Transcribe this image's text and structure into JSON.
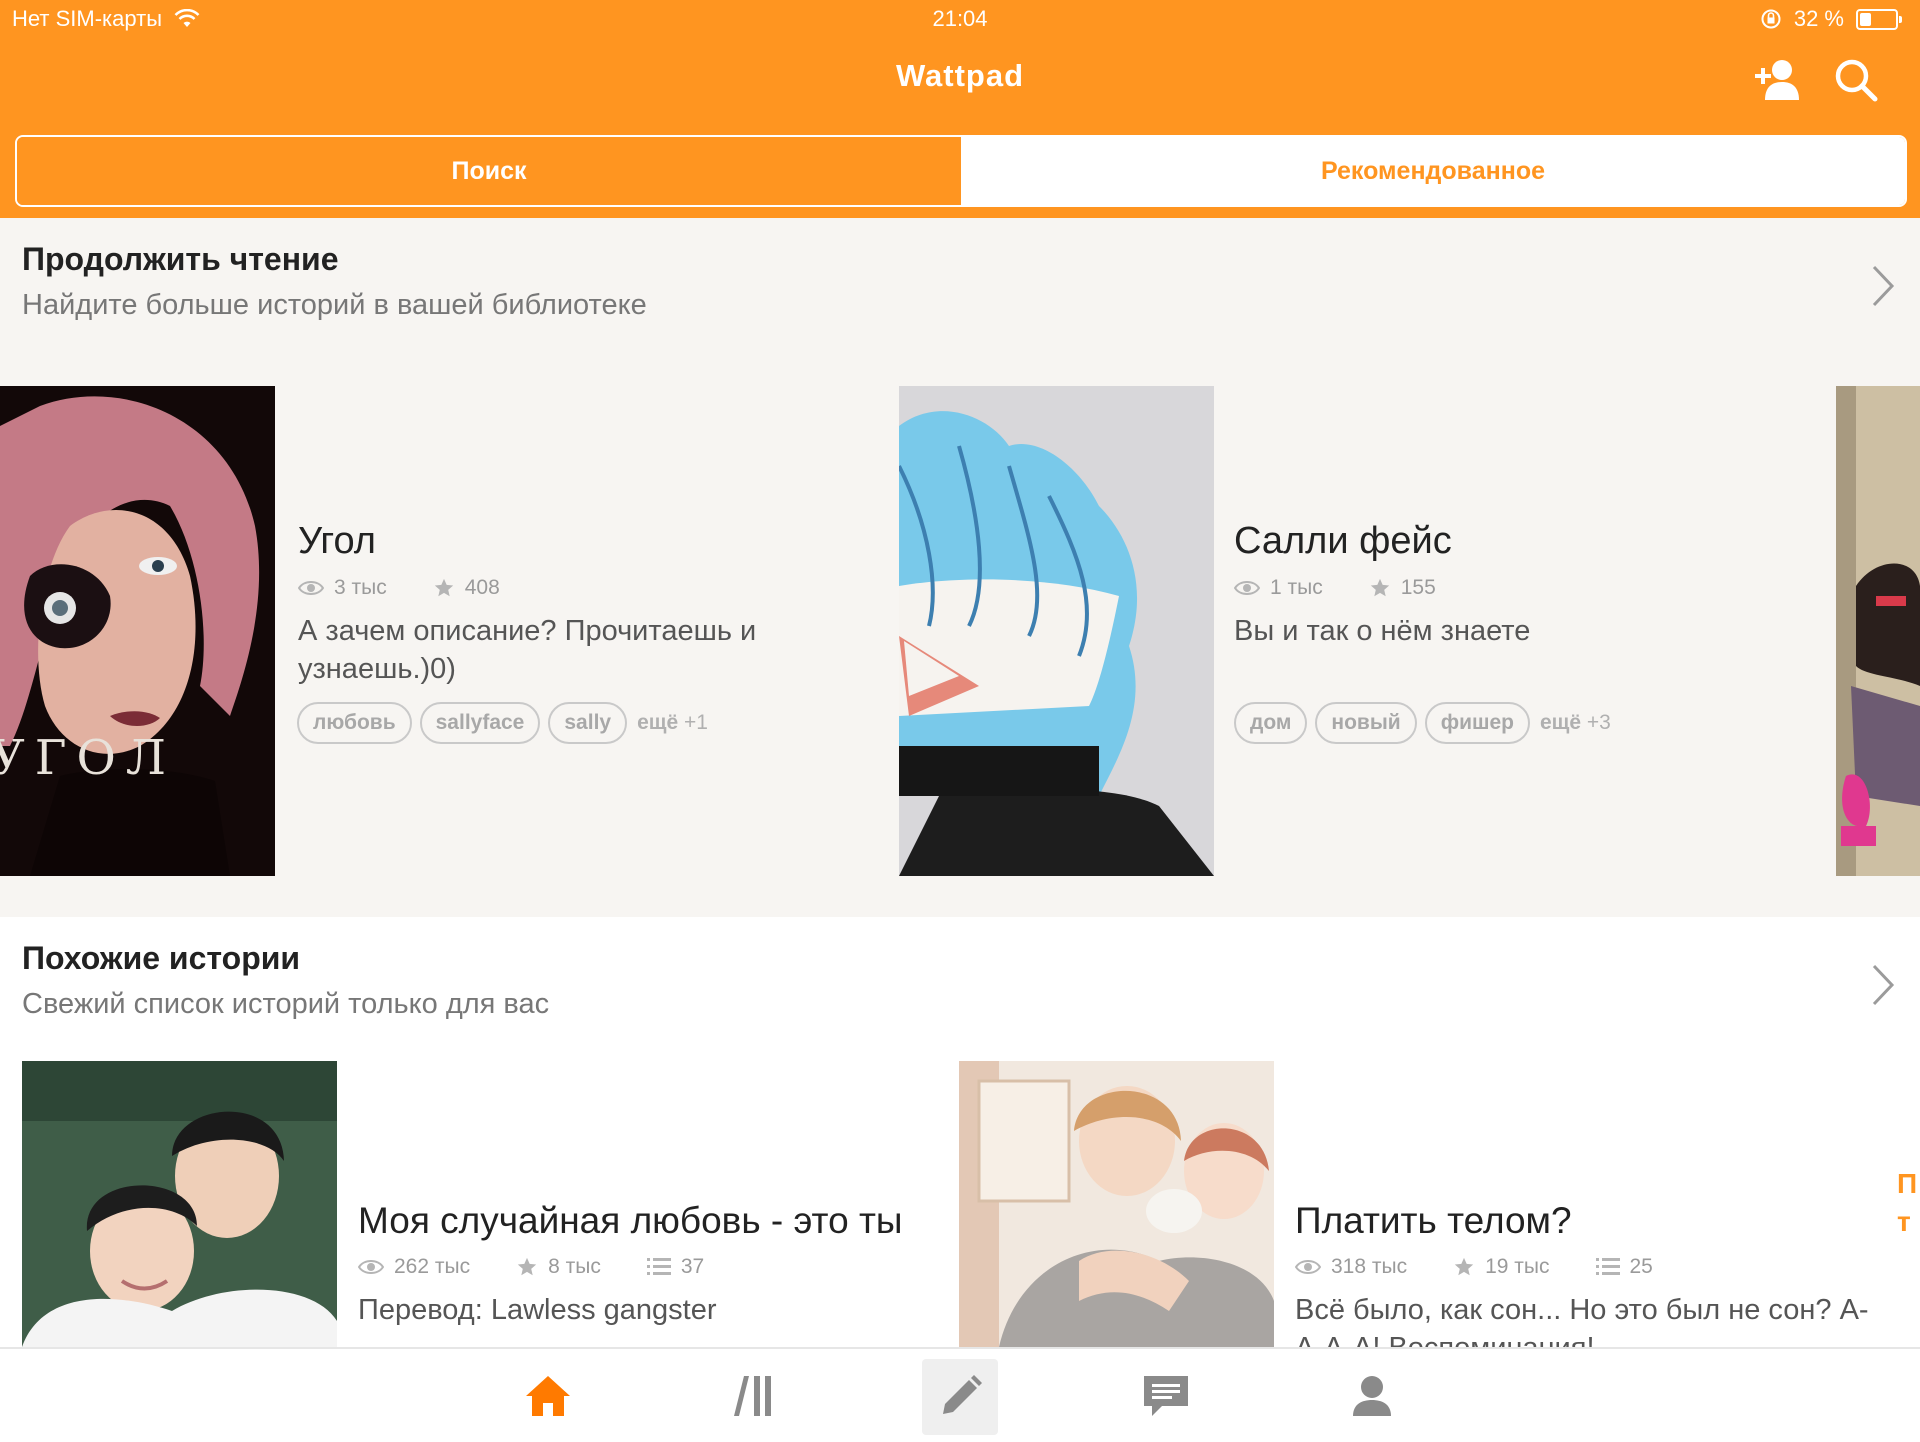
{
  "status_bar": {
    "carrier": "Нет SIM-карты",
    "time": "21:04",
    "battery": "32 %",
    "battery_level": 0.32
  },
  "header": {
    "title": "Wattpad",
    "icons": [
      "add-friend-icon",
      "search-icon"
    ]
  },
  "tabs": [
    {
      "label": "Поиск",
      "active": true
    },
    {
      "label": "Рекомендованное",
      "active": false
    }
  ],
  "continue_reading": {
    "title": "Продолжить чтение",
    "subtitle": "Найдите больше историй в вашей библиотеке",
    "books": [
      {
        "title": "Угол",
        "cover_text": "УГОЛ",
        "reads": "3 тыс",
        "votes": "408",
        "description": "А зачем описание? Прочитаешь и узнаешь.)0)",
        "tags": [
          "любовь",
          "sallyface",
          "sally"
        ],
        "more_label": "ещё",
        "more_count": "+1"
      },
      {
        "title": "Салли фейс",
        "reads": "1 тыс",
        "votes": "155",
        "description": "Вы и так о нём знаете",
        "tags": [
          "дом",
          "новый",
          "фишер"
        ],
        "more_label": "ещё",
        "more_count": "+3"
      }
    ]
  },
  "similar_stories": {
    "title": "Похожие истории",
    "subtitle": "Свежий список историй только для вас",
    "books": [
      {
        "title": "Моя случайная любовь - это ты",
        "reads": "262 тыс",
        "votes": "8 тыс",
        "parts": "37",
        "description": "Перевод: Lawless gangster"
      },
      {
        "title": "Платить телом?",
        "reads": "318 тыс",
        "votes": "19 тыс",
        "parts": "25",
        "description": "Всё было, как сон...  Но это был не сон? А-А-А-А! Воспоминания!"
      }
    ],
    "peek_text": [
      "П",
      "т"
    ]
  },
  "tab_bar": {
    "items": [
      {
        "icon": "home-icon",
        "selected": true
      },
      {
        "icon": "library-icon",
        "selected": false
      },
      {
        "icon": "write-icon",
        "selected": false
      },
      {
        "icon": "messages-icon",
        "selected": false
      },
      {
        "icon": "profile-icon",
        "selected": false
      }
    ]
  },
  "colors": {
    "accent": "#ff9520",
    "background": "#f7f5f2",
    "text": "#222222",
    "muted": "#777777"
  }
}
